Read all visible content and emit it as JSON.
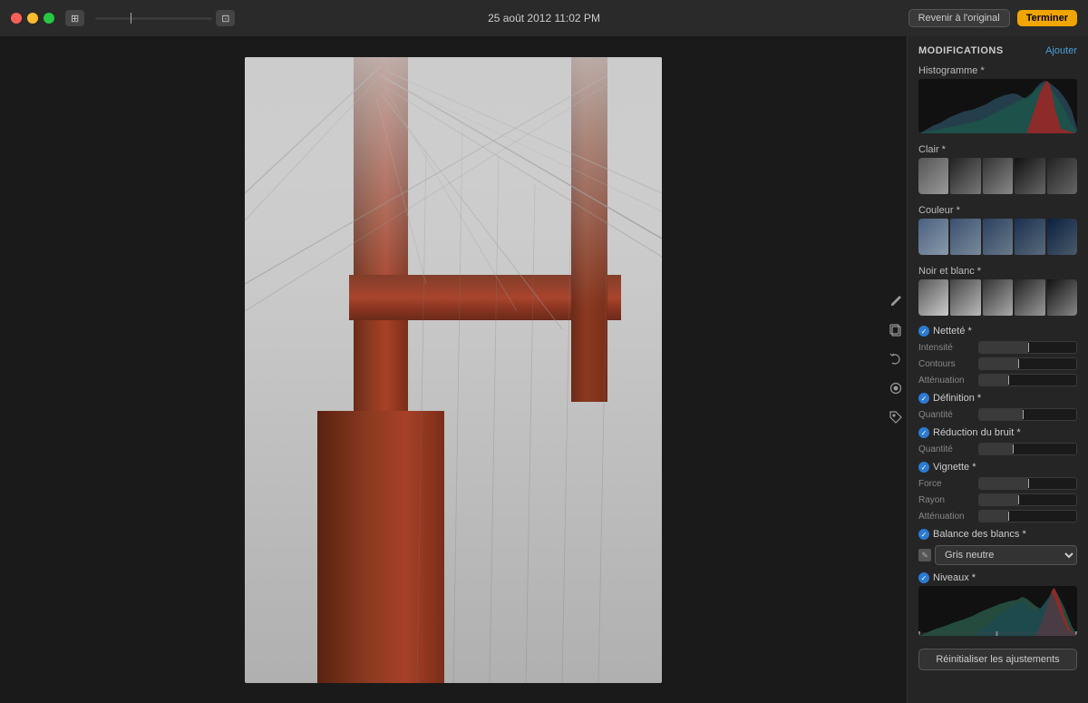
{
  "titlebar": {
    "title": "25 août 2012 11:02 PM",
    "revert_label": "Revenir à l'original",
    "done_label": "Terminer"
  },
  "panel": {
    "modifications_label": "MODIFICATIONS",
    "ajouter_label": "Ajouter",
    "histogram_label": "Histogramme *",
    "clair_label": "Clair *",
    "couleur_label": "Couleur *",
    "noir_blanc_label": "Noir et blanc *",
    "nettete_label": "Netteté *",
    "nettete_sliders": [
      {
        "label": "Intensité",
        "value": 50
      },
      {
        "label": "Contours",
        "value": 40
      },
      {
        "label": "Atténuation",
        "value": 30
      }
    ],
    "definition_label": "Définition *",
    "definition_sliders": [
      {
        "label": "Quantité",
        "value": 45
      }
    ],
    "reduction_bruit_label": "Réduction du bruit *",
    "reduction_sliders": [
      {
        "label": "Quantité",
        "value": 35
      }
    ],
    "vignette_label": "Vignette *",
    "vignette_sliders": [
      {
        "label": "Force",
        "value": 50
      },
      {
        "label": "Rayon",
        "value": 40
      },
      {
        "label": "Atténuation",
        "value": 30
      }
    ],
    "balance_blancs_label": "Balance des blancs *",
    "balance_option": "Gris neutre",
    "niveaux_label": "Niveaux *",
    "reset_label": "Réinitialiser les ajustements"
  },
  "tools": [
    "✏️",
    "📋",
    "🔄",
    "⚙️",
    "🖊️"
  ]
}
